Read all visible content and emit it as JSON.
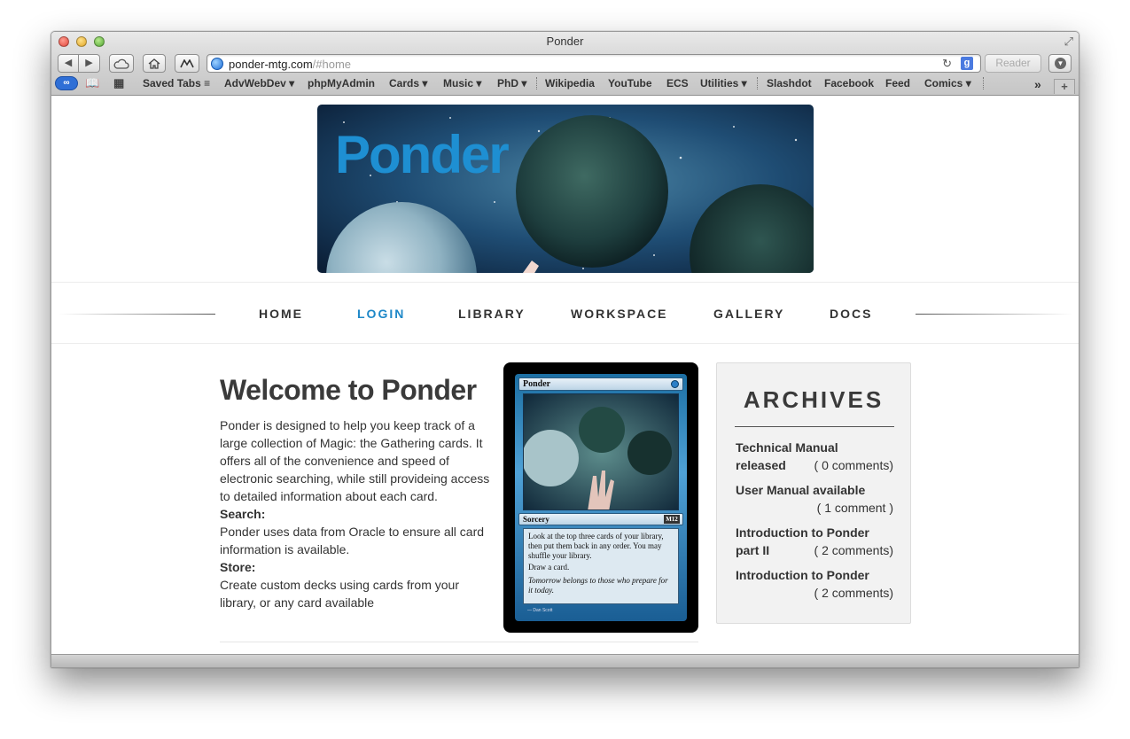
{
  "window": {
    "title": "Ponder"
  },
  "toolbar": {
    "back": "◀",
    "forward": "▶",
    "url_host": "ponder-mtg.com",
    "url_path": "/#home",
    "reader": "Reader"
  },
  "bookmarks": [
    "Saved Tabs",
    "AdvWebDev",
    "phpMyAdmin",
    "Cards",
    "Music",
    "PhD",
    "Wikipedia",
    "YouTube",
    "ECS",
    "Utilities",
    "Slashdot",
    "Facebook",
    "Feed",
    "Comics"
  ],
  "banner": {
    "title": "Ponder"
  },
  "nav": [
    "HOME",
    "LOGIN",
    "LIBRARY",
    "WORKSPACE",
    "GALLERY",
    "DOCS"
  ],
  "nav_active": "LOGIN",
  "main": {
    "heading": "Welcome to Ponder",
    "intro": "Ponder is designed to help you keep track of a large collection of Magic: the Gathering cards. It offers all of the convenience and speed of electronic searching, while still provideing access to detailed information about each card.",
    "search_label": "Search:",
    "search_text": "Ponder uses data from Oracle to ensure all card information is available.",
    "store_label": "Store:",
    "store_text": "Create custom decks using cards from your library, or any card available"
  },
  "card": {
    "name": "Ponder",
    "type": "Sorcery",
    "set": "M12",
    "rules": [
      "Look at the top three cards of your library, then put them back in any order. You may shuffle your library.",
      "Draw a card."
    ],
    "flavor": "Tomorrow belongs to those who prepare for it today.",
    "artist": "Dan Scott"
  },
  "archives": {
    "title": "ARCHIVES",
    "items": [
      {
        "title_1": "Technical Manual",
        "title_2": "released",
        "comments": "( 0 comments)"
      },
      {
        "title_1": "User Manual available",
        "title_2": "",
        "comments": "( 1 comment )"
      },
      {
        "title_1": "Introduction to Ponder",
        "title_2": "part II",
        "comments": "( 2 comments)"
      },
      {
        "title_1": "Introduction to Ponder",
        "title_2": "",
        "comments": "( 2 comments)"
      }
    ]
  },
  "colors": {
    "accent": "#1e88c8",
    "banner_title": "#1e8fd2",
    "heading": "#3a3a3a"
  }
}
